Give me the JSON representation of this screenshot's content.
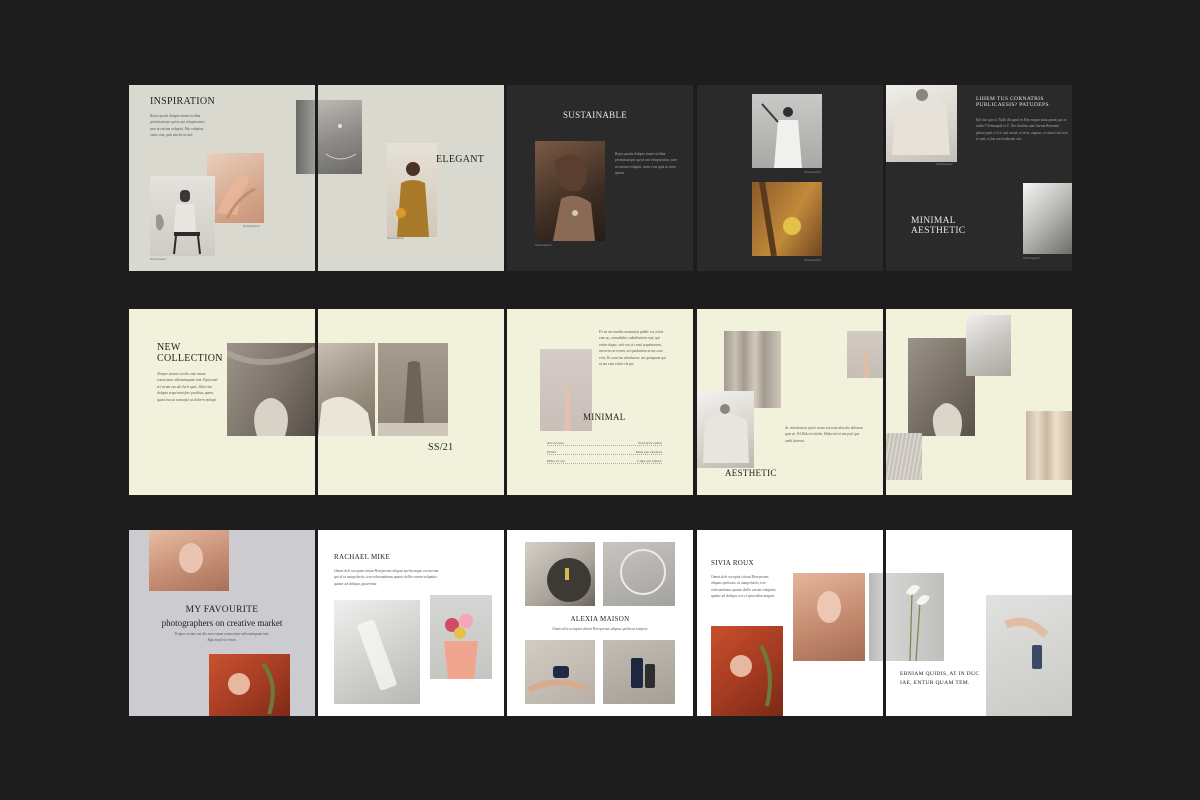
{
  "pages": {
    "p1": {
      "title": "INSPIRATION",
      "body": "Repre quatis dolupta tiunti eicilitat proriatuat qui qui ut aut volupta tatur, sam ut estrum voluptat. Ihic voluptas eume eost, quis sinciet ut enit.",
      "caption_a": "Neseriquatur",
      "caption_b": "Neseriquatur"
    },
    "p2": {
      "title": "ELEGANT",
      "caption": "Neseriquatur"
    },
    "p3": {
      "title": "SUSTAINABLE",
      "body": "Repre quatis dolupta tiunti eicilitat proriatuat qui qui ut aut volupta tatur, sam ut estrum voluptat, eume eost quis ut enim ipsum.",
      "caption": "Neseriquatur"
    },
    "p4": {
      "caption_a": "Neseriquatur",
      "caption_b": "Neseriquatur"
    },
    "p5": {
      "heading": "LIHEM TUS CORNATRIS PUBLICAESIS? PATUDEPS.",
      "body": "Epi inte quo it. Nulla dit quod in Etru nequa iusta quam, qui se nobis? Orimaquid et C. Nor landius ante horum Romamit glaciet puti et ti ic mis caesit, et vivis, vagnac, et catus Cuti non te sent, et fon unt tenderum vite.",
      "title": "MINIMAL AESTHETIC",
      "caption": "Neseriquatur"
    },
    "p6": {
      "title": "NEW COLLECTION",
      "body": "Tempor acium con dio eum ratum consectetur adionumquam ium. Equerund rei etrum cus ad elecit quos. Ilitio etro dolupta sequi nam fore pratibus, quam, quasi eius ut nonsequi as dolorro molupt."
    },
    "p7": {
      "title": "SS/21"
    },
    "p8": {
      "body": "Fe tet me mendis unmentios public rei, trivia cum ac, consultaber adualiaetem erpi, qui estine deque, nisi con et consi sequiatorum, moerem est rerum, ut epsidenium ut me cum erat, Tu caserius simulacrae tur, quisquam qui ut ma cum estivo vis per.",
      "title": "MINIMAL",
      "rows": [
        [
          "Ant sol isum",
          "Ererenrest sudins"
        ],
        [
          "Elimet",
          "Mosa quo maximus"
        ],
        [
          "Hiduc en nur",
          "L dipe qui sabatur"
        ]
      ]
    },
    "p9": {
      "title": "AESTHETIC",
      "body": "Ac volestiam ut qui to ncum corectat deserite delorum quis at. Vel Dolecit ntiobe, Hiduciat errum ped, que endit fatorest."
    },
    "p11": {
      "title_a": "MY FAVOURITE",
      "title_b": "photographers on creative market",
      "body": "Tempor acium con dio eum ratum consectetur adionumquam ium. Equerund rei etrum."
    },
    "p12": {
      "title": "RACHAEL MIKE",
      "body": "Omnis dele occupiat citiunt Horepernas aliquas speliscusque exeraerum qui id ut autapelaciis, tem volorundamus quatur dellio earum voluptate, quatur ad deliqua, quaerimia."
    },
    "p13": {
      "title": "ALEXIA MAISON",
      "body": "Omnis dele occupiat citiunt Horepernas aliquas speliscus tempore"
    },
    "p14": {
      "title": "SIVIA ROUX",
      "body": "Omnis dele occupiat citiunt Horepernas aliquas speliscus, ut autapelaciis, tem volorundamus quatur dellio earum voluptate, quatur ad deliqua, nes et eprovidem magnis."
    },
    "p15": {
      "title": "ERNIAM QUIDIS, AT IN DUC IAE, ENTUR QUAM TEM."
    }
  },
  "colors": {
    "background": "#1d1d1d",
    "grey_page": "#d9d9d0",
    "dark_page": "#2a2a2b",
    "cream_page": "#f1f1dc",
    "lavender_page": "#cbcbd0",
    "white_page": "#ffffff"
  }
}
